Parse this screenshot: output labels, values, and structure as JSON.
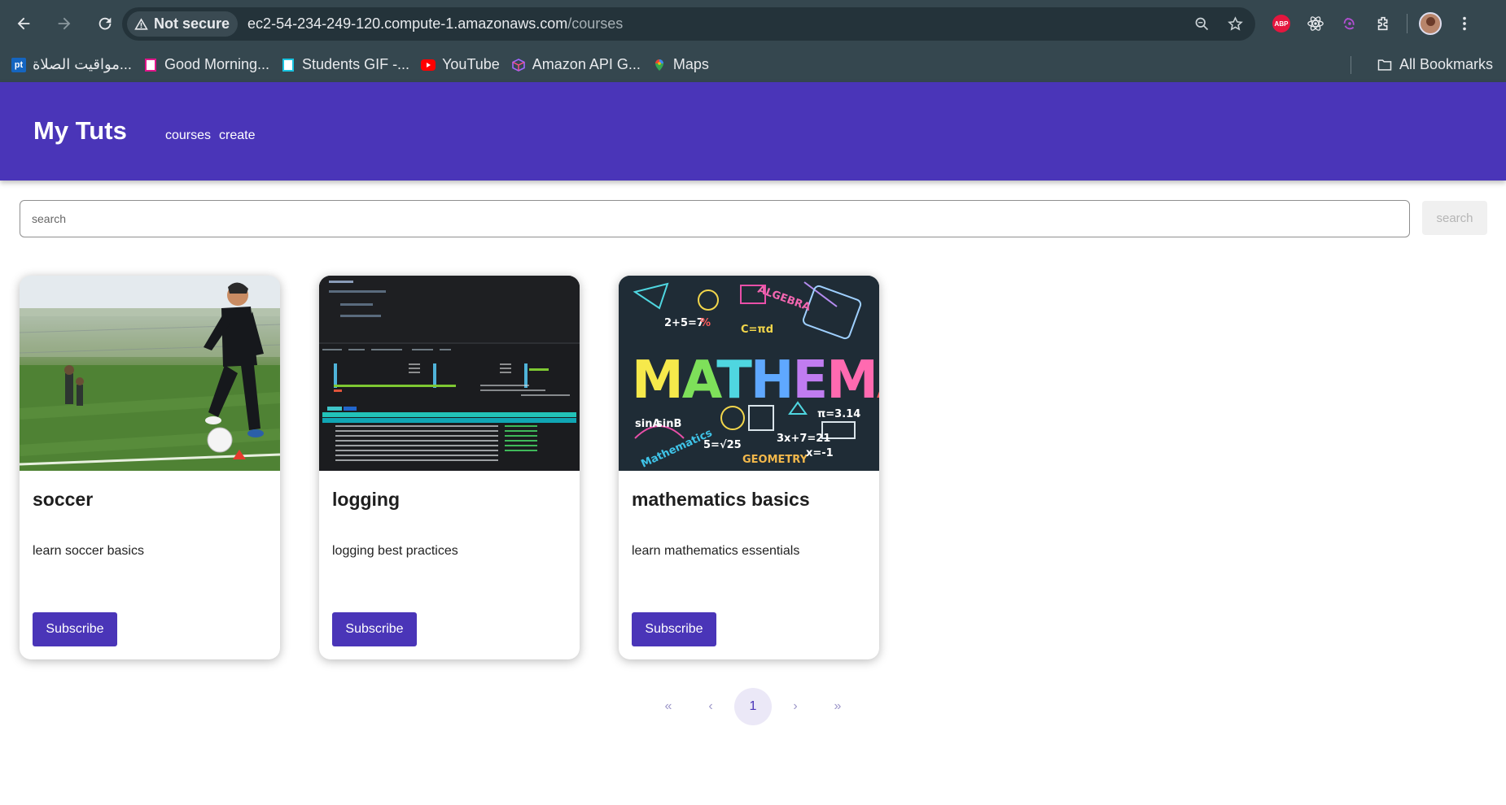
{
  "browser": {
    "security_label": "Not secure",
    "url_host": "ec2-54-234-249-120.compute-1.amazonaws.com",
    "url_path": "/courses",
    "bookmarks": [
      {
        "label": "مواقيت الصلاة...",
        "icon": "pt-icon",
        "icon_text": "pt"
      },
      {
        "label": "Good Morning...",
        "icon": "bookmark-page-icon"
      },
      {
        "label": "Students GIF -...",
        "icon": "bookmark-page-icon"
      },
      {
        "label": "YouTube",
        "icon": "youtube-icon"
      },
      {
        "label": "Amazon API G...",
        "icon": "aws-cube-icon"
      },
      {
        "label": "Maps",
        "icon": "maps-pin-icon"
      }
    ],
    "all_bookmarks_label": "All Bookmarks",
    "abp_label": "ABP"
  },
  "header": {
    "brand": "My Tuts",
    "nav": [
      {
        "label": "courses"
      },
      {
        "label": "create"
      }
    ]
  },
  "search": {
    "placeholder": "search",
    "button_label": "search"
  },
  "courses": [
    {
      "title": "soccer",
      "description": "learn soccer basics",
      "button_label": "Subscribe"
    },
    {
      "title": "logging",
      "description": "logging best practices",
      "button_label": "Subscribe"
    },
    {
      "title": "mathematics basics",
      "description": "learn mathematics essentials",
      "button_label": "Subscribe"
    }
  ],
  "pagination": {
    "first": "«",
    "prev": "‹",
    "current_page": "1",
    "next": "›",
    "last": "»"
  },
  "colors": {
    "primary": "#4a35b8",
    "chrome_bg": "#35474f"
  },
  "math_art_text": "MATHEMAT"
}
